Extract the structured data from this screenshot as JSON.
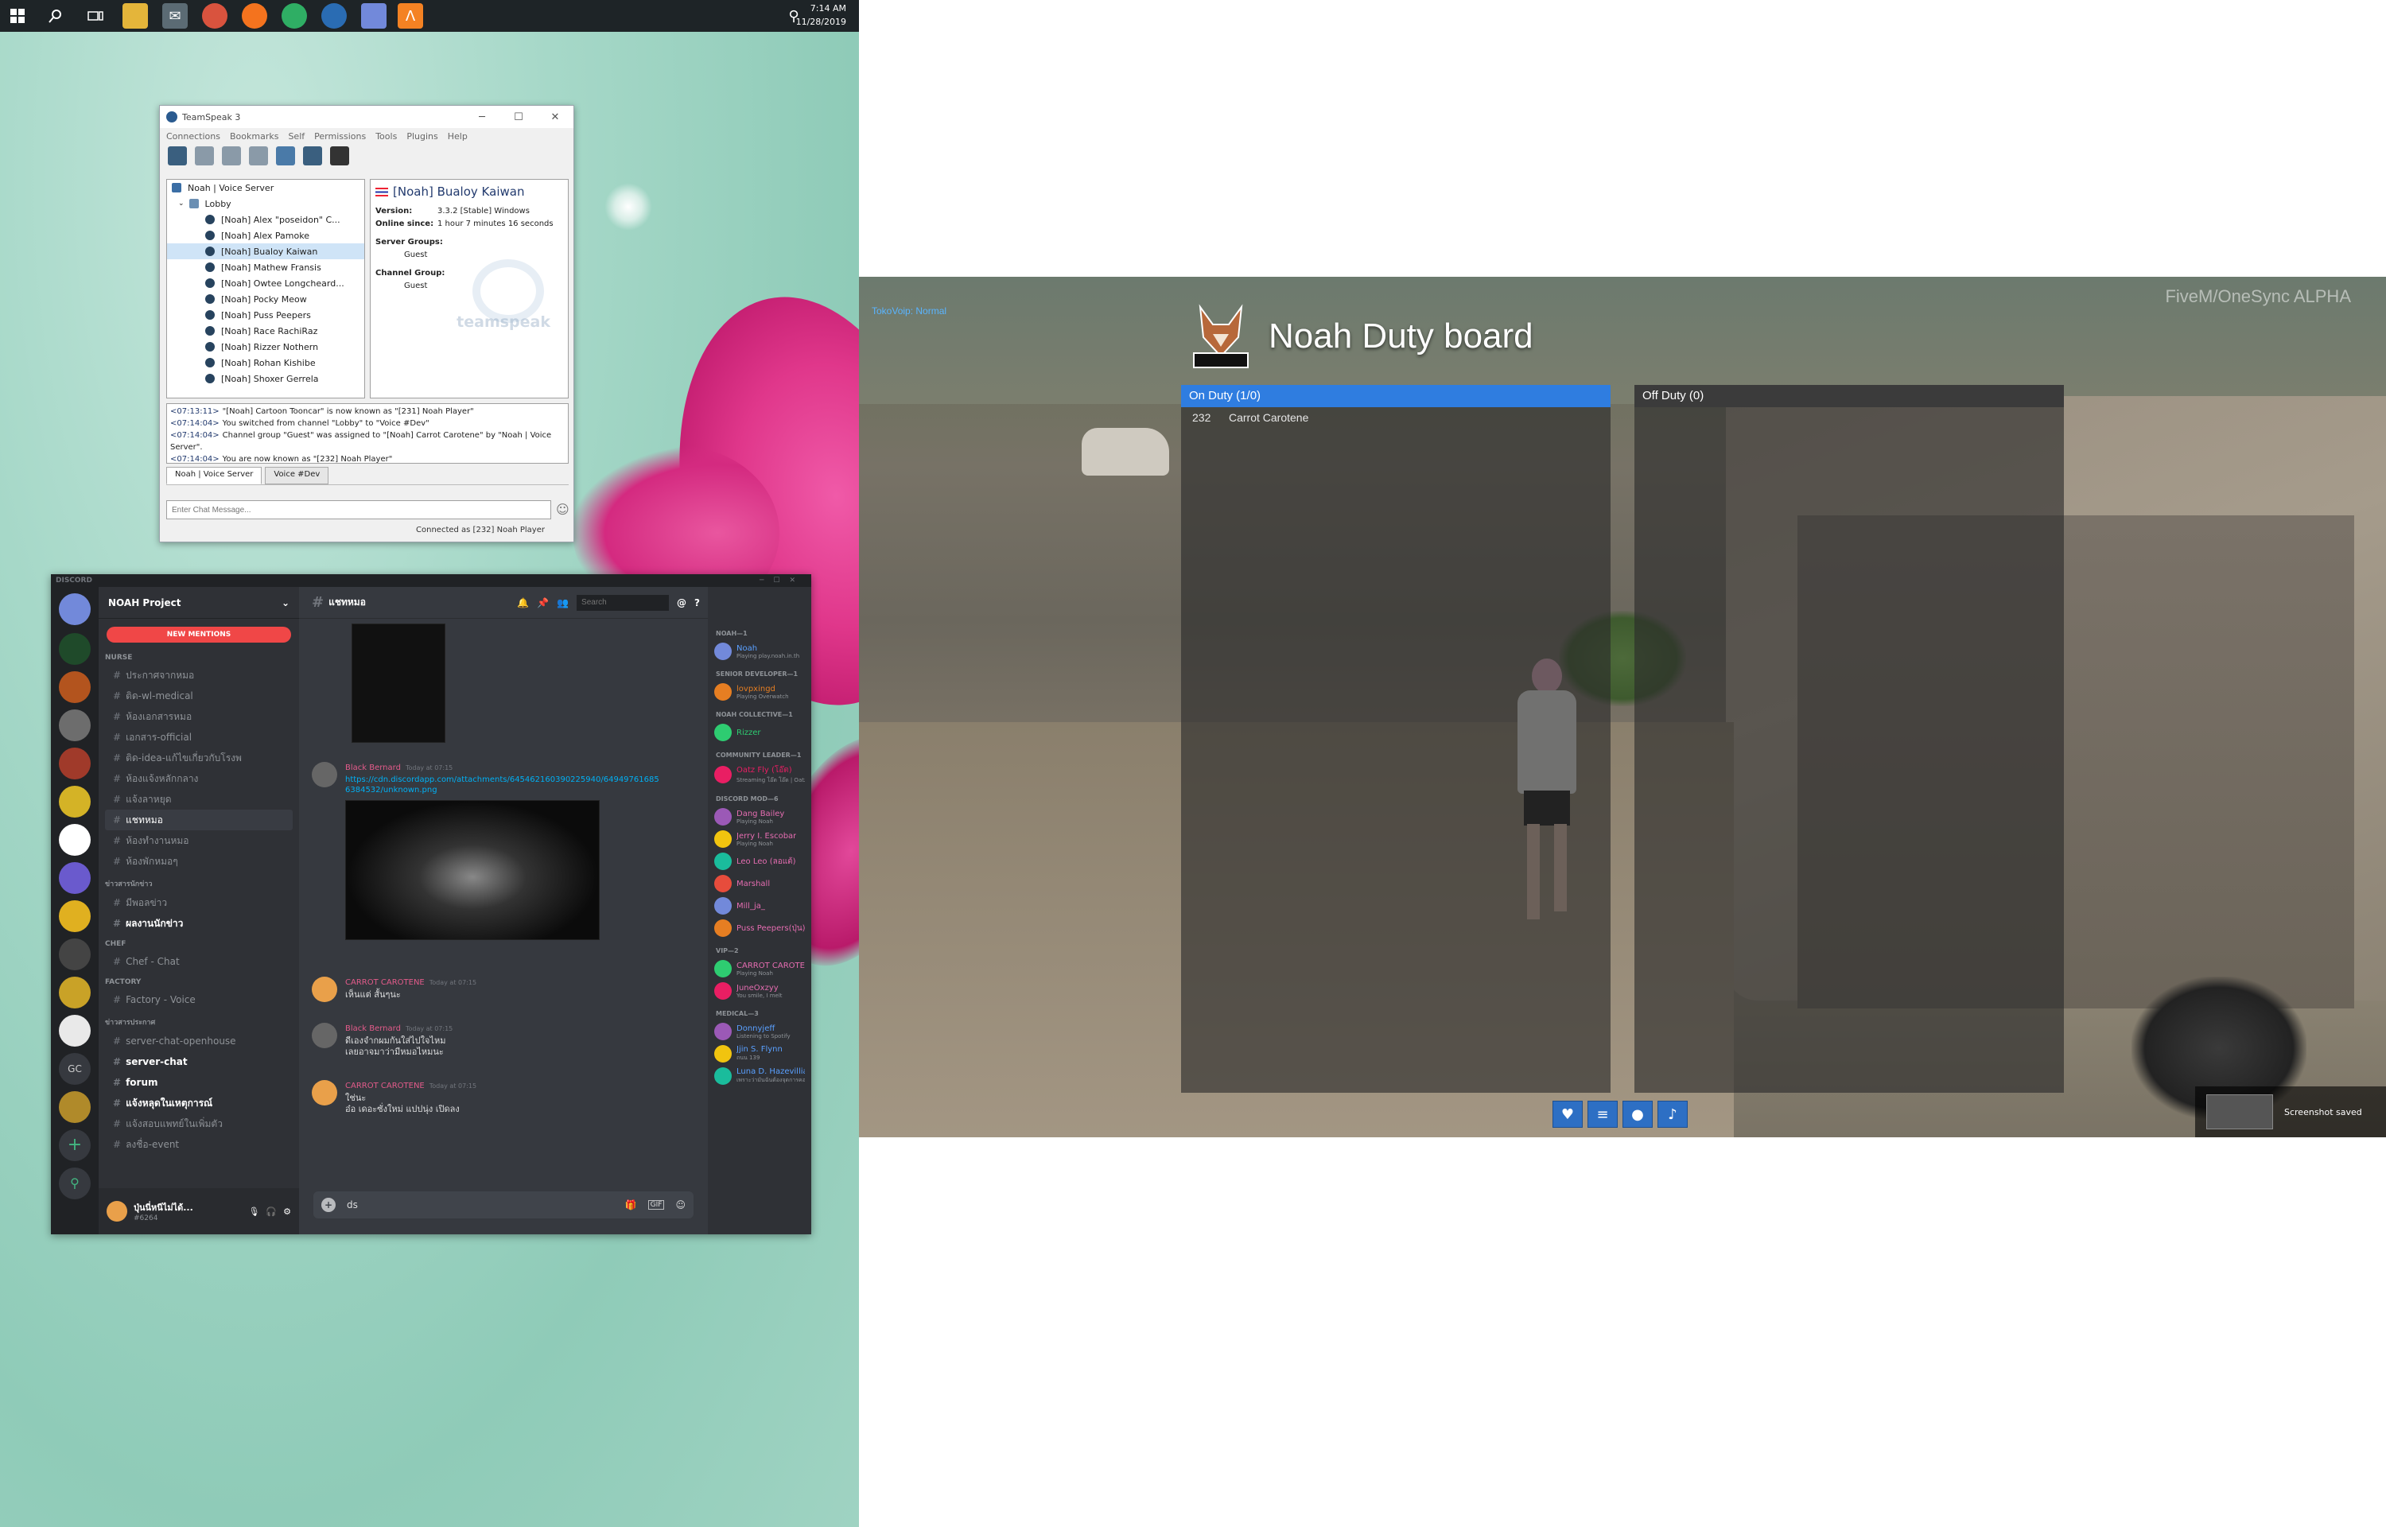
{
  "taskbar": {
    "time": "7:14 AM",
    "date": "11/28/2019"
  },
  "teamspeak": {
    "title": "TeamSpeak 3",
    "menu": [
      "Connections",
      "Bookmarks",
      "Self",
      "Permissions",
      "Tools",
      "Plugins",
      "Help"
    ],
    "server": "Noah | Voice Server",
    "channel": "Lobby",
    "clients": [
      "[Noah] Alex \"poseidon\" C...",
      "[Noah] Alex Pamoke",
      "[Noah] Bualoy Kaiwan",
      "[Noah] Mathew Fransis",
      "[Noah] Owtee Longcheard...",
      "[Noah] Pocky Meow",
      "[Noah] Puss Peepers",
      "[Noah] Race RachiRaz",
      "[Noah] Rizzer Nothern",
      "[Noah] Rohan Kishibe",
      "[Noah] Shoxer Gerrela"
    ],
    "info": {
      "name": "[Noah] Bualoy Kaiwan",
      "version_label": "Version:",
      "version": "3.3.2 [Stable] Windows",
      "online_label": "Online since:",
      "online": "1 hour 7 minutes 16 seconds",
      "server_groups_label": "Server Groups:",
      "server_group": "Guest",
      "channel_group_label": "Channel Group:",
      "channel_group": "Guest",
      "watermark": "teamspeak"
    },
    "log": [
      {
        "t": "<07:13:11>",
        "m": "\"[Noah] Cartoon Tooncar\" is now known as \"[231] Noah Player\""
      },
      {
        "t": "<07:14:04>",
        "m": "You switched from channel \"Lobby\" to \"Voice #Dev\""
      },
      {
        "t": "<07:14:04>",
        "m": "Channel group \"Guest\" was assigned to \"[Noah] Carrot Carotene\" by \"Noah | Voice Server\"."
      },
      {
        "t": "<07:14:04>",
        "m": "You are now known as \"[232] Noah Player\""
      }
    ],
    "tabs": [
      "Noah | Voice Server",
      "Voice #Dev"
    ],
    "chat_placeholder": "Enter Chat Message...",
    "status": "Connected as [232] Noah Player"
  },
  "discord": {
    "brand": "DISCORD",
    "server_name": "NOAH Project",
    "new_mentions": "NEW MENTIONS",
    "channel_title": "แชทหมอ",
    "search_placeholder": "Search",
    "categories": [
      {
        "name": "NURSE",
        "channels": [
          {
            "name": "ประกาศจากหมอ",
            "state": "normal"
          },
          {
            "name": "ติด-wl-medical",
            "state": "normal"
          },
          {
            "name": "ห้องเอกสารหมอ",
            "state": "normal"
          },
          {
            "name": "เอกสาร-official",
            "state": "normal"
          },
          {
            "name": "ติด-idea-แก้ไขเกี่ยวกับโรงพ",
            "state": "normal"
          },
          {
            "name": "ห้องแจ้งหลักกลาง",
            "state": "normal"
          },
          {
            "name": "แจ้งลาหยุด",
            "state": "normal"
          },
          {
            "name": "แชทหมอ",
            "state": "selected"
          },
          {
            "name": "ห้องทำงานหมอ",
            "state": "normal"
          },
          {
            "name": "ห้องพักหมอๆ",
            "state": "normal"
          }
        ]
      },
      {
        "name": "ข่าวสารนักข่าว",
        "channels": [
          {
            "name": "มีพอลข่าว",
            "state": "normal"
          },
          {
            "name": "ผลงานนักข่าว",
            "state": "unread"
          }
        ]
      },
      {
        "name": "CHEF",
        "channels": [
          {
            "name": "Chef - Chat",
            "state": "normal"
          }
        ]
      },
      {
        "name": "FACTORY",
        "channels": [
          {
            "name": "Factory - Voice",
            "state": "normal"
          }
        ]
      },
      {
        "name": "ข่าวสารประกาศ",
        "channels": [
          {
            "name": "server-chat-openhouse",
            "state": "normal"
          },
          {
            "name": "server-chat",
            "state": "unread"
          },
          {
            "name": "forum",
            "state": "unread"
          },
          {
            "name": "แจ้งหลุดในเหตุการณ์",
            "state": "unread"
          },
          {
            "name": "แจ้งสอบแพทย์ในเพิ่มตัว",
            "state": "normal"
          },
          {
            "name": "ลงชื่อ-event",
            "state": "normal"
          }
        ]
      }
    ],
    "user": {
      "name": "ปุ่นนี่หนีไม่ได้...",
      "tag": "#6264"
    },
    "messages": [
      {
        "author": "Black Bernard",
        "time": "Today at 07:15",
        "link": "https://cdn.discordapp.com/attachments/645462160390225940/649497616856384532/unknown.png"
      },
      {
        "author": "CARROT CAROTENE",
        "time": "Today at 07:15",
        "text": "เห็นแต่ สั้นๆนะ"
      },
      {
        "author": "Black Bernard",
        "time": "Today at 07:15",
        "text": "ดีเองจำกผมกันใส่ไปใจไหม\nเลยอาจมาว่ามีหมอไหมนะ"
      },
      {
        "author": "CARROT CAROTENE",
        "time": "Today at 07:15",
        "text": "ใช่นะ\nอ๋อ เดอะซั่งใหม่ แปปนุ่ง เปิดลง"
      }
    ],
    "input_value": "ds",
    "members": [
      {
        "cat": "NOAH—1",
        "list": [
          {
            "name": "Noah",
            "sub": "Playing play.noah.in.th",
            "color": "#5aa0ff"
          }
        ]
      },
      {
        "cat": "SENIOR DEVELOPER—1",
        "list": [
          {
            "name": "lovpxingd",
            "sub": "Playing Overwatch",
            "color": "#e67e22"
          }
        ]
      },
      {
        "cat": "NOAH COLLECTIVE—1",
        "list": [
          {
            "name": "Rizzer",
            "sub": "",
            "color": "#2ecc71"
          }
        ]
      },
      {
        "cat": "COMMUNITY LEADER—1",
        "list": [
          {
            "name": "Oatz Fly (โอ๊ต)",
            "sub": "Streaming โอ๊ต โอ๊ต | Oatz ...",
            "color": "#e91e63"
          }
        ]
      },
      {
        "cat": "DISCORD MOD—6",
        "list": [
          {
            "name": "Dang Bailey",
            "sub": "Playing Noah",
            "color": "#e56db1"
          },
          {
            "name": "Jerry I. Escobar",
            "sub": "Playing Noah",
            "color": "#e56db1"
          },
          {
            "name": "Leo Leo (ลอแต้)",
            "sub": "",
            "color": "#e56db1"
          },
          {
            "name": "Marshall",
            "sub": "",
            "color": "#e56db1"
          },
          {
            "name": "Mill_ja_",
            "sub": "",
            "color": "#e56db1"
          },
          {
            "name": "Puss Peepers(ปุ่น)",
            "sub": "",
            "color": "#e56db1"
          }
        ]
      },
      {
        "cat": "VIP—2",
        "list": [
          {
            "name": "CARROT CAROTENE",
            "sub": "Playing Noah",
            "color": "#e56db1"
          },
          {
            "name": "JuneOxzyy",
            "sub": "You smile, I melt",
            "color": "#e56db1"
          }
        ]
      },
      {
        "cat": "MEDICAL—3",
        "list": [
          {
            "name": "Donnyjeff",
            "sub": "Listening to Spotify",
            "color": "#5aa0ff"
          },
          {
            "name": "Jjin S. Flynn",
            "sub": "ถนน 139",
            "color": "#5aa0ff"
          },
          {
            "name": "Luna D. Hazevillian",
            "sub": "เพราะว่ามันฉันต้องจุดการคอง",
            "color": "#5aa0ff"
          }
        ]
      }
    ]
  },
  "game": {
    "title": "Noah Duty board",
    "logo_text": "NOAH",
    "voip": "TokoVoip: Normal",
    "watermark": "FiveM/OneSync ALPHA",
    "on_duty_label": "On Duty (1/0)",
    "off_duty_label": "Off Duty (0)",
    "on_duty_rows": [
      {
        "id": "232",
        "name": "Carrot Carotene"
      }
    ],
    "off_duty_rows": [],
    "hud_icons": [
      "heart-icon",
      "burger-icon",
      "water-drop-icon",
      "speaker-icon"
    ],
    "screenshot_toast": "Screenshot saved"
  }
}
